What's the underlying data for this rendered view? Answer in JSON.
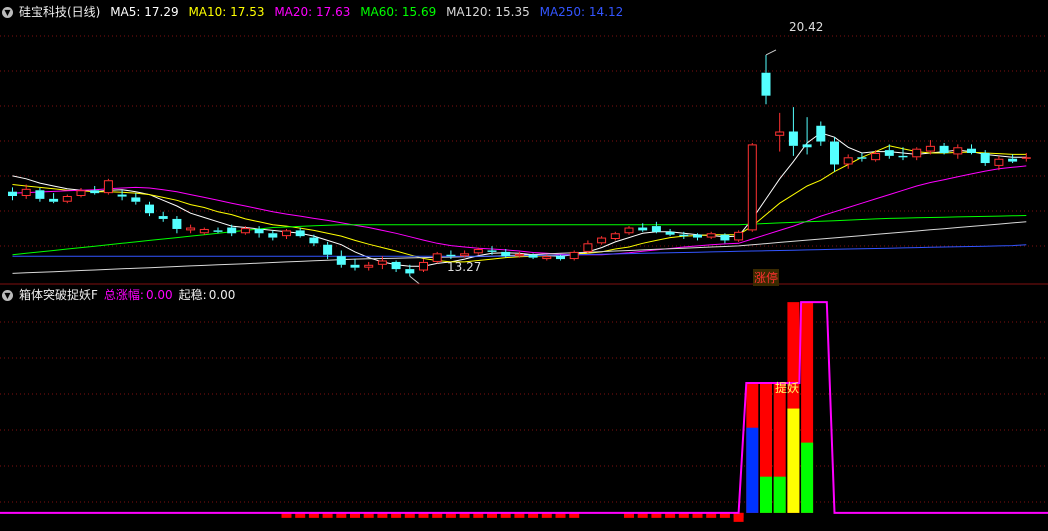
{
  "header": {
    "title": "硅宝科技(日线)",
    "ma": [
      {
        "label": "MA5: 17.29",
        "color": "#ffffff"
      },
      {
        "label": "MA10: 17.53",
        "color": "#ffff00"
      },
      {
        "label": "MA20: 17.63",
        "color": "#ff00ff"
      },
      {
        "label": "MA60: 15.69",
        "color": "#00ff00"
      },
      {
        "label": "MA120: 15.35",
        "color": "#d8d8d8"
      },
      {
        "label": "MA250: 14.12",
        "color": "#3355ff"
      }
    ]
  },
  "annotations": {
    "high": "20.42",
    "low": "13.27",
    "limit_up": "涨停",
    "signal": "提妖"
  },
  "indicator": {
    "title": "箱体突破捉妖F",
    "total_label": "总涨幅:",
    "total_value": "0.00",
    "start_label": "起稳:",
    "start_value": "0.00"
  },
  "colors": {
    "up": "#ff3232",
    "down": "#54ffff",
    "grid": "#801010",
    "magenta": "#ff00ff",
    "yellow": "#ffff00",
    "red": "#ff0000",
    "blue": "#0033ff",
    "green": "#00ff00"
  },
  "chart_data": [
    {
      "type": "candlestick",
      "ylim": [
        12.5,
        21.5
      ],
      "candles": [
        [
          15.65,
          15.8,
          15.35,
          15.5
        ],
        [
          15.5,
          15.9,
          15.4,
          15.75
        ],
        [
          15.7,
          15.78,
          15.3,
          15.4
        ],
        [
          15.4,
          15.6,
          15.25,
          15.3
        ],
        [
          15.3,
          15.55,
          15.25,
          15.5
        ],
        [
          15.5,
          15.78,
          15.45,
          15.7
        ],
        [
          15.7,
          15.85,
          15.55,
          15.6
        ],
        [
          15.6,
          16.1,
          15.55,
          16.05
        ],
        [
          15.55,
          15.7,
          15.35,
          15.48
        ],
        [
          15.45,
          15.6,
          15.2,
          15.3
        ],
        [
          15.2,
          15.3,
          14.8,
          14.9
        ],
        [
          14.8,
          14.95,
          14.6,
          14.7
        ],
        [
          14.7,
          14.8,
          14.2,
          14.35
        ],
        [
          14.3,
          14.5,
          14.2,
          14.4
        ],
        [
          14.2,
          14.4,
          14.15,
          14.35
        ],
        [
          14.3,
          14.4,
          14.2,
          14.25
        ],
        [
          14.4,
          14.5,
          14.1,
          14.2
        ],
        [
          14.2,
          14.45,
          14.15,
          14.38
        ],
        [
          14.35,
          14.45,
          14.05,
          14.2
        ],
        [
          14.2,
          14.3,
          13.95,
          14.05
        ],
        [
          14.1,
          14.35,
          14.0,
          14.3
        ],
        [
          14.3,
          14.4,
          14.05,
          14.1
        ],
        [
          14.05,
          14.15,
          13.75,
          13.85
        ],
        [
          13.8,
          13.9,
          13.3,
          13.45
        ],
        [
          13.4,
          13.6,
          13.0,
          13.1
        ],
        [
          13.1,
          13.3,
          12.9,
          13.0
        ],
        [
          13.0,
          13.2,
          12.9,
          13.1
        ],
        [
          13.1,
          13.4,
          12.95,
          13.25
        ],
        [
          13.2,
          13.25,
          12.85,
          12.95
        ],
        [
          12.95,
          13.1,
          12.7,
          12.8
        ],
        [
          12.9,
          13.3,
          12.85,
          13.2
        ],
        [
          13.2,
          13.55,
          13.15,
          13.5
        ],
        [
          13.45,
          13.6,
          13.3,
          13.4
        ],
        [
          13.4,
          13.6,
          13.35,
          13.5
        ],
        [
          13.5,
          13.7,
          13.45,
          13.65
        ],
        [
          13.6,
          13.75,
          13.45,
          13.55
        ],
        [
          13.55,
          13.65,
          13.35,
          13.4
        ],
        [
          13.4,
          13.55,
          13.35,
          13.48
        ],
        [
          13.45,
          13.5,
          13.3,
          13.35
        ],
        [
          13.3,
          13.45,
          13.25,
          13.4
        ],
        [
          13.4,
          13.45,
          13.25,
          13.3
        ],
        [
          13.3,
          13.6,
          13.25,
          13.55
        ],
        [
          13.55,
          13.95,
          13.5,
          13.85
        ],
        [
          13.85,
          14.1,
          13.8,
          14.05
        ],
        [
          14.0,
          14.25,
          13.95,
          14.2
        ],
        [
          14.2,
          14.45,
          14.15,
          14.4
        ],
        [
          14.4,
          14.55,
          14.25,
          14.3
        ],
        [
          14.45,
          14.6,
          14.2,
          14.25
        ],
        [
          14.25,
          14.35,
          14.1,
          14.15
        ],
        [
          14.15,
          14.25,
          14.0,
          14.1
        ],
        [
          14.15,
          14.2,
          13.95,
          14.05
        ],
        [
          14.05,
          14.25,
          14.0,
          14.2
        ],
        [
          14.15,
          14.2,
          13.85,
          13.95
        ],
        [
          13.95,
          14.3,
          13.9,
          14.25
        ],
        [
          14.3,
          17.35,
          14.25,
          17.3
        ],
        [
          19.8,
          20.42,
          18.7,
          19.0
        ],
        [
          17.6,
          18.4,
          17.05,
          17.75
        ],
        [
          17.75,
          18.6,
          16.9,
          17.25
        ],
        [
          17.3,
          18.25,
          16.95,
          17.2
        ],
        [
          17.95,
          18.1,
          17.25,
          17.4
        ],
        [
          17.4,
          17.55,
          16.35,
          16.6
        ],
        [
          16.6,
          16.95,
          16.45,
          16.85
        ],
        [
          16.85,
          17.0,
          16.7,
          16.8
        ],
        [
          16.75,
          17.1,
          16.7,
          17.0
        ],
        [
          17.1,
          17.3,
          16.8,
          16.9
        ],
        [
          16.9,
          17.2,
          16.75,
          16.85
        ],
        [
          16.85,
          17.2,
          16.75,
          17.15
        ],
        [
          17.05,
          17.45,
          16.95,
          17.25
        ],
        [
          17.25,
          17.35,
          16.95,
          17.0
        ],
        [
          16.95,
          17.3,
          16.8,
          17.2
        ],
        [
          17.15,
          17.3,
          16.95,
          17.0
        ],
        [
          17.0,
          17.1,
          16.55,
          16.65
        ],
        [
          16.55,
          16.9,
          16.4,
          16.8
        ],
        [
          16.8,
          16.95,
          16.65,
          16.7
        ],
        [
          16.8,
          17.0,
          16.7,
          16.85
        ]
      ],
      "ma": {
        "MA5": [
          16.2,
          16.1,
          15.95,
          15.85,
          15.75,
          15.7,
          15.65,
          15.7,
          15.72,
          15.65,
          15.55,
          15.35,
          15.15,
          14.9,
          14.75,
          14.6,
          14.45,
          14.4,
          14.35,
          14.3,
          14.25,
          14.2,
          14.1,
          13.95,
          13.8,
          13.55,
          13.35,
          13.2,
          13.1,
          13.05,
          13.05,
          13.15,
          13.2,
          13.3,
          13.42,
          13.5,
          13.52,
          13.5,
          13.45,
          13.42,
          13.4,
          13.45,
          13.55,
          13.7,
          13.9,
          14.05,
          14.2,
          14.25,
          14.25,
          14.2,
          14.15,
          14.12,
          14.08,
          14.1,
          14.7,
          15.4,
          16.1,
          16.7,
          17.35,
          17.7,
          17.55,
          17.2,
          17.0,
          17.05,
          17.05,
          17.0,
          16.95,
          17.0,
          17.05,
          17.1,
          17.05,
          16.95,
          16.9,
          16.85,
          16.85
        ],
        "MA10": [
          15.9,
          15.85,
          15.8,
          15.75,
          15.7,
          15.68,
          15.65,
          15.65,
          15.63,
          15.6,
          15.55,
          15.45,
          15.35,
          15.2,
          15.1,
          14.95,
          14.85,
          14.7,
          14.6,
          14.5,
          14.45,
          14.38,
          14.3,
          14.2,
          14.1,
          13.95,
          13.82,
          13.7,
          13.58,
          13.45,
          13.32,
          13.25,
          13.2,
          13.2,
          13.25,
          13.3,
          13.35,
          13.38,
          13.4,
          13.42,
          13.45,
          13.47,
          13.5,
          13.55,
          13.65,
          13.72,
          13.85,
          13.95,
          14.05,
          14.1,
          14.12,
          14.15,
          14.15,
          14.15,
          14.45,
          14.85,
          15.25,
          15.55,
          15.85,
          16.05,
          16.35,
          16.6,
          16.85,
          17.05,
          17.25,
          17.15,
          17.05,
          17.0,
          17.0,
          17.02,
          17.03,
          17.0,
          16.98,
          16.95,
          16.95
        ],
        "MA20": [
          15.6,
          15.62,
          15.64,
          15.66,
          15.68,
          15.7,
          15.72,
          15.75,
          15.78,
          15.8,
          15.78,
          15.72,
          15.65,
          15.55,
          15.45,
          15.35,
          15.25,
          15.15,
          15.05,
          14.95,
          14.87,
          14.8,
          14.72,
          14.65,
          14.57,
          14.48,
          14.4,
          14.3,
          14.2,
          14.08,
          13.96,
          13.85,
          13.77,
          13.72,
          13.68,
          13.65,
          13.62,
          13.58,
          13.53,
          13.5,
          13.47,
          13.45,
          13.45,
          13.45,
          13.48,
          13.52,
          13.57,
          13.62,
          13.67,
          13.72,
          13.76,
          13.8,
          13.83,
          13.85,
          14.0,
          14.15,
          14.3,
          14.45,
          14.62,
          14.8,
          14.95,
          15.1,
          15.25,
          15.4,
          15.55,
          15.7,
          15.85,
          15.97,
          16.07,
          16.17,
          16.27,
          16.37,
          16.45,
          16.5,
          16.55
        ],
        "MA60": [
          13.45,
          13.5,
          13.55,
          13.6,
          13.65,
          13.7,
          13.75,
          13.8,
          13.85,
          13.9,
          13.95,
          14.0,
          14.05,
          14.1,
          14.15,
          14.2,
          14.25,
          14.3,
          14.35,
          14.4,
          14.42,
          14.44,
          14.46,
          14.48,
          14.5,
          14.5,
          14.5,
          14.5,
          14.5,
          14.5,
          14.5,
          14.5,
          14.5,
          14.5,
          14.5,
          14.5,
          14.5,
          14.5,
          14.5,
          14.5,
          14.5,
          14.5,
          14.5,
          14.5,
          14.5,
          14.5,
          14.5,
          14.5,
          14.5,
          14.5,
          14.5,
          14.5,
          14.5,
          14.5,
          14.52,
          14.54,
          14.56,
          14.58,
          14.6,
          14.62,
          14.64,
          14.66,
          14.68,
          14.7,
          14.72,
          14.73,
          14.74,
          14.75,
          14.76,
          14.77,
          14.78,
          14.79,
          14.8,
          14.81,
          14.82
        ],
        "MA120": [
          12.8,
          12.82,
          12.84,
          12.86,
          12.88,
          12.9,
          12.92,
          12.94,
          12.96,
          12.98,
          13.0,
          13.02,
          13.04,
          13.06,
          13.08,
          13.1,
          13.12,
          13.14,
          13.16,
          13.18,
          13.2,
          13.22,
          13.24,
          13.26,
          13.28,
          13.3,
          13.31,
          13.32,
          13.33,
          13.34,
          13.35,
          13.36,
          13.37,
          13.38,
          13.39,
          13.4,
          13.42,
          13.44,
          13.46,
          13.48,
          13.5,
          13.52,
          13.54,
          13.56,
          13.58,
          13.6,
          13.62,
          13.64,
          13.66,
          13.68,
          13.7,
          13.72,
          13.74,
          13.76,
          13.8,
          13.84,
          13.88,
          13.92,
          13.96,
          14.0,
          14.04,
          14.08,
          14.12,
          14.16,
          14.2,
          14.24,
          14.28,
          14.32,
          14.36,
          14.4,
          14.44,
          14.48,
          14.52,
          14.56,
          14.6
        ],
        "MA250": [
          13.4,
          13.4,
          13.4,
          13.4,
          13.4,
          13.4,
          13.4,
          13.4,
          13.4,
          13.4,
          13.4,
          13.4,
          13.4,
          13.4,
          13.4,
          13.4,
          13.4,
          13.4,
          13.4,
          13.4,
          13.4,
          13.4,
          13.4,
          13.4,
          13.4,
          13.4,
          13.4,
          13.4,
          13.4,
          13.4,
          13.4,
          13.4,
          13.4,
          13.4,
          13.4,
          13.4,
          13.4,
          13.41,
          13.42,
          13.43,
          13.44,
          13.45,
          13.46,
          13.47,
          13.48,
          13.49,
          13.5,
          13.51,
          13.52,
          13.53,
          13.54,
          13.55,
          13.56,
          13.57,
          13.58,
          13.59,
          13.6,
          13.61,
          13.62,
          13.63,
          13.64,
          13.65,
          13.66,
          13.67,
          13.68,
          13.69,
          13.7,
          13.71,
          13.72,
          13.73,
          13.74,
          13.75,
          13.76,
          13.77,
          13.8
        ]
      },
      "title": "",
      "xlabel": "",
      "ylabel": "",
      "grid": true
    },
    {
      "type": "bar",
      "ylim": [
        -1,
        100
      ],
      "negative_bars": {
        "from": 20,
        "to": 41,
        "value": -0.6
      },
      "negative_bars_2": {
        "from": 45,
        "to": 53,
        "value": -0.6
      },
      "tall_neg_index": 53,
      "line": [
        [
          0,
          0
        ],
        [
          53,
          0
        ],
        [
          54,
          61
        ],
        [
          57,
          61
        ],
        [
          58,
          99
        ],
        [
          59,
          99
        ],
        [
          60,
          0
        ],
        [
          74,
          0
        ]
      ],
      "bars": [
        {
          "index": 54,
          "red": 61,
          "segments": [
            {
              "h": 40,
              "color": "blue"
            }
          ]
        },
        {
          "index": 55,
          "red": 61,
          "segments": [
            {
              "h": 17,
              "color": "green"
            }
          ]
        },
        {
          "index": 56,
          "red": 61,
          "segments": [
            {
              "h": 17,
              "color": "green"
            }
          ]
        },
        {
          "index": 57,
          "red": 99,
          "segments": [
            {
              "h": 49,
              "color": "yellow"
            }
          ]
        },
        {
          "index": 58,
          "red": 99,
          "segments": [
            {
              "h": 33,
              "color": "green"
            }
          ]
        }
      ],
      "title": "",
      "xlabel": "",
      "ylabel": "",
      "grid": true
    }
  ]
}
